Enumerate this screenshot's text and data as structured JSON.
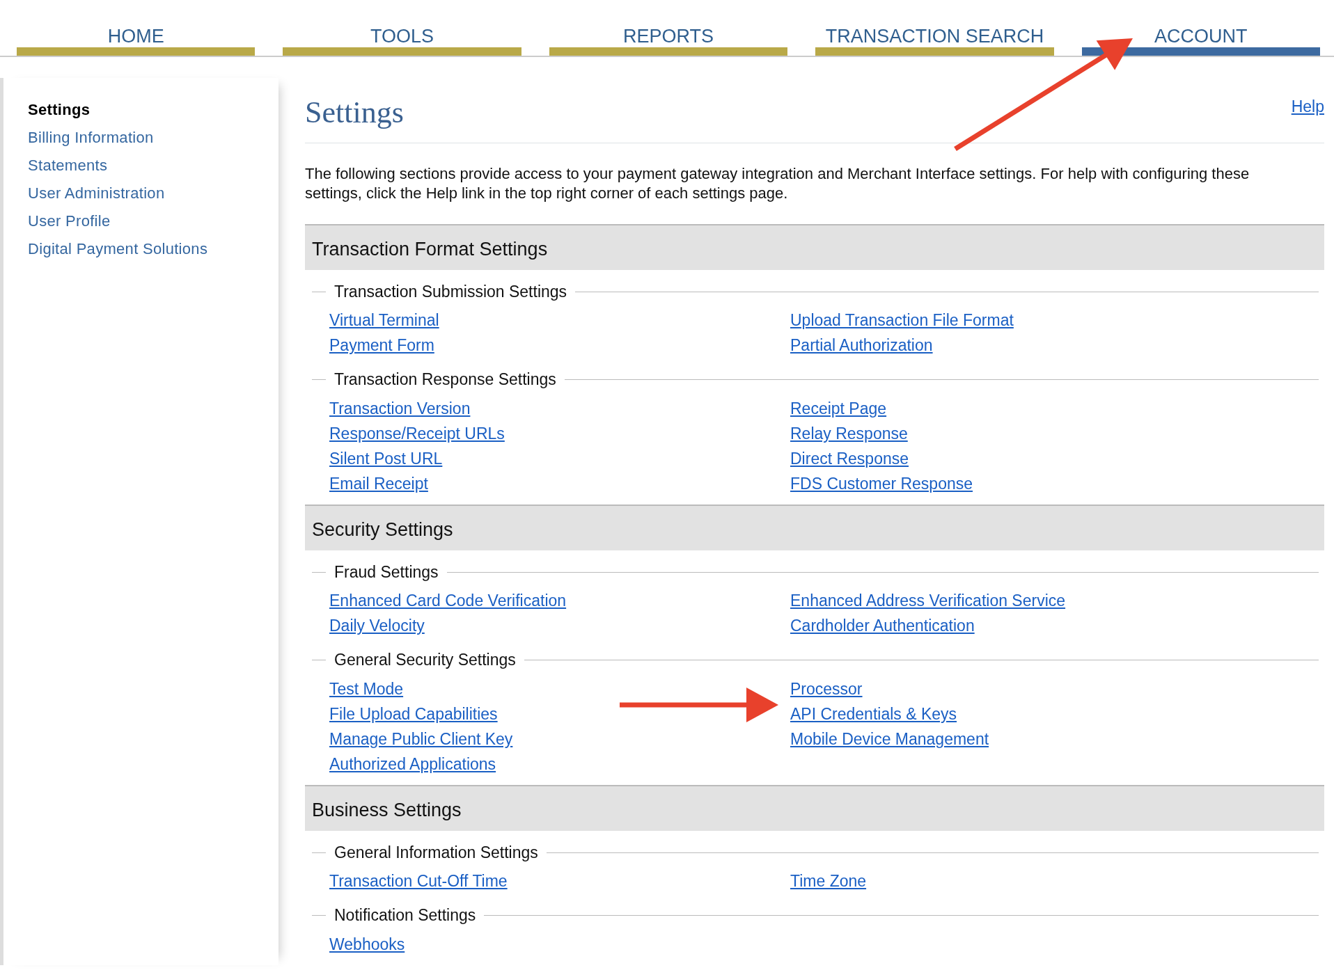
{
  "nav_tabs": [
    {
      "label": "HOME",
      "selected": false
    },
    {
      "label": "TOOLS",
      "selected": false
    },
    {
      "label": "REPORTS",
      "selected": false
    },
    {
      "label": "TRANSACTION SEARCH",
      "selected": false
    },
    {
      "label": "ACCOUNT",
      "selected": true
    }
  ],
  "sidebar": {
    "items": [
      {
        "label": "Settings",
        "selected": true
      },
      {
        "label": "Billing Information",
        "selected": false
      },
      {
        "label": "Statements",
        "selected": false
      },
      {
        "label": "User Administration",
        "selected": false
      },
      {
        "label": "User Profile",
        "selected": false
      },
      {
        "label": "Digital Payment Solutions",
        "selected": false
      }
    ]
  },
  "page": {
    "title": "Settings",
    "help_link": "Help",
    "intro": "The following sections provide access to your payment gateway integration and Merchant Interface settings. For help with configuring these settings, click the Help link in the top right corner of each settings page.",
    "sections": [
      {
        "title": "Transaction Format Settings",
        "groups": [
          {
            "title": "Transaction Submission Settings",
            "links": [
              "Virtual Terminal",
              "Upload Transaction File Format",
              "Payment Form",
              "Partial Authorization"
            ]
          },
          {
            "title": "Transaction Response Settings",
            "links": [
              "Transaction Version",
              "Receipt Page",
              "Response/Receipt URLs",
              "Relay Response",
              "Silent Post URL",
              "Direct Response",
              "Email Receipt",
              "FDS Customer Response"
            ]
          }
        ]
      },
      {
        "title": "Security Settings",
        "groups": [
          {
            "title": "Fraud Settings",
            "links": [
              "Enhanced Card Code Verification",
              "Enhanced Address Verification Service",
              "Daily Velocity",
              "Cardholder Authentication"
            ]
          },
          {
            "title": "General Security Settings",
            "links": [
              "Test Mode",
              "Processor",
              "File Upload Capabilities",
              "API Credentials & Keys",
              "Manage Public Client Key",
              "Mobile Device Management",
              "Authorized Applications"
            ]
          }
        ]
      },
      {
        "title": "Business Settings",
        "groups": [
          {
            "title": "General Information Settings",
            "links": [
              "Transaction Cut-Off Time",
              "Time Zone"
            ]
          },
          {
            "title": "Notification Settings",
            "links": [
              "Webhooks"
            ]
          }
        ]
      }
    ]
  },
  "annotation_arrows": [
    {
      "kind": "diagonal"
    },
    {
      "kind": "horizontal"
    }
  ]
}
